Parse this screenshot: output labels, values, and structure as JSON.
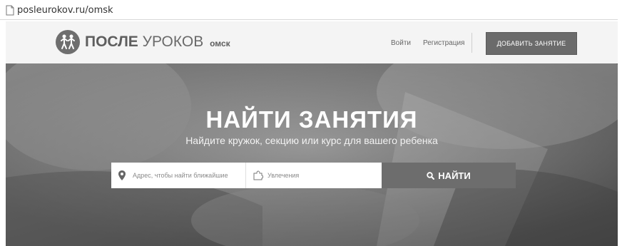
{
  "browser": {
    "url": "posleurokov.ru/omsk"
  },
  "header": {
    "logo": {
      "bold": "ПОСЛЕ",
      "light": "УРОКОВ",
      "city": "омск"
    },
    "nav": {
      "login": "Войти",
      "register": "Регистрация"
    },
    "add_button": "ДОБАВИТЬ ЗАНЯТИЕ"
  },
  "hero": {
    "title": "НАЙТИ ЗАНЯТИЯ",
    "subtitle": "Найдите кружок, секцию или курс для вашего ребенка"
  },
  "search": {
    "address_placeholder": "Адрес, чтобы найти ближайшие",
    "hobby_placeholder": "Увлечения",
    "button": "НАЙТИ"
  },
  "icons": {
    "page": "page-icon",
    "logo": "kids-logo-icon",
    "location": "location-pin-icon",
    "hobby": "puzzle-icon",
    "search": "search-icon"
  },
  "colors": {
    "header_bg": "#f4f4f4",
    "button_bg": "#6b6b6b",
    "hero_overlay": "#7c7c7c",
    "text_dark": "#5e5e5e"
  }
}
